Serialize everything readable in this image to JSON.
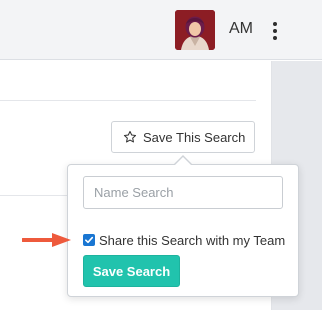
{
  "header": {
    "user_initials": "AM",
    "avatar_icon": "user-avatar",
    "menu_icon": "kebab-menu-icon"
  },
  "toolbar": {
    "save_this_search_label": "Save This Search",
    "save_this_search_icon": "star-outline-icon"
  },
  "popover": {
    "name_input_placeholder": "Name Search",
    "name_input_value": "",
    "share_checkbox_checked": true,
    "share_label": "Share this Search with my Team",
    "save_button_label": "Save Search"
  },
  "colors": {
    "accent_button": "#21c3ad",
    "checkbox": "#1976d2",
    "pointer_arrow": "#ee5a3c",
    "avatar_bg": "#8c1d24"
  }
}
